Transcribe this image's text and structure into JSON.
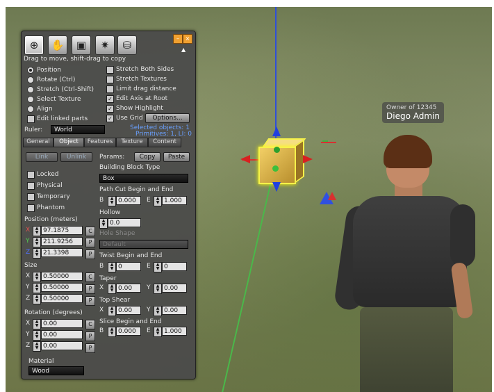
{
  "nametag": {
    "owner": "Owner of 12345",
    "name": "Diego Admin"
  },
  "tools": {
    "icons": [
      "zoom-icon",
      "move-icon",
      "edit-icon",
      "create-wand-icon",
      "land-icon"
    ],
    "glyphs": [
      "⊕",
      "✋",
      "▣",
      "✷",
      "⛁"
    ],
    "minimize": "–",
    "close": "×",
    "expand": "▲"
  },
  "hint": "Drag to move, shift-drag to copy",
  "modes": [
    {
      "label": "Position",
      "selected": true
    },
    {
      "label": "Rotate (Ctrl)",
      "selected": false
    },
    {
      "label": "Stretch (Ctrl-Shift)",
      "selected": false
    },
    {
      "label": "Select Texture",
      "selected": false
    },
    {
      "label": "Align",
      "selected": false
    }
  ],
  "edit_linked": {
    "label": "Edit linked parts",
    "checked": false
  },
  "options": [
    {
      "label": "Stretch Both Sides",
      "checked": false
    },
    {
      "label": "Stretch Textures",
      "checked": false
    },
    {
      "label": "Limit drag distance",
      "checked": false
    },
    {
      "label": "Edit Axis at Root",
      "checked": true
    },
    {
      "label": "Show Highlight",
      "checked": true
    },
    {
      "label": "Use Grid",
      "checked": true
    }
  ],
  "options_button": "Options...",
  "ruler": {
    "label": "Ruler:",
    "value": "World"
  },
  "selected_objects": "Selected objects: 1",
  "primitives": "Primitives: 1, LI: 0",
  "tabs": [
    "General",
    "Object",
    "Features",
    "Texture",
    "Content"
  ],
  "link_btn": "Link",
  "unlink_btn": "Unlink",
  "params": {
    "label": "Params:",
    "copy": "Copy",
    "paste": "Paste"
  },
  "flags": [
    {
      "label": "Locked"
    },
    {
      "label": "Physical"
    },
    {
      "label": "Temporary"
    },
    {
      "label": "Phantom"
    }
  ],
  "position": {
    "title": "Position (meters)",
    "rows": [
      {
        "axis": "X",
        "value": "97.1875",
        "btn": "C",
        "color": "#e05050"
      },
      {
        "axis": "Y",
        "value": "211.9256",
        "btn": "P",
        "color": "#50d050"
      },
      {
        "axis": "Z",
        "value": "21.3398",
        "btn": "P",
        "color": "#5070ff"
      }
    ]
  },
  "size": {
    "title": "Size",
    "rows": [
      {
        "axis": "X",
        "value": "0.50000",
        "btn": "C"
      },
      {
        "axis": "Y",
        "value": "0.50000",
        "btn": "P"
      },
      {
        "axis": "Z",
        "value": "0.50000",
        "btn": "P"
      }
    ]
  },
  "rotation": {
    "title": "Rotation (degrees)",
    "rows": [
      {
        "axis": "X",
        "value": "0.00",
        "btn": "C"
      },
      {
        "axis": "Y",
        "value": "0.00",
        "btn": "P"
      },
      {
        "axis": "Z",
        "value": "0.00",
        "btn": "P"
      }
    ]
  },
  "material": {
    "label": "Material",
    "value": "Wood"
  },
  "shape": {
    "title": "Building Block Type",
    "value": "Box",
    "path_cut": {
      "title": "Path Cut Begin and End",
      "b_label": "B",
      "b": "0.000",
      "e_label": "E",
      "e": "1.000"
    },
    "hollow": {
      "title": "Hollow",
      "value": "0.0"
    },
    "hole": {
      "title": "Hole Shape",
      "value": "Default"
    },
    "twist": {
      "title": "Twist Begin and End",
      "b_label": "B",
      "b": "0",
      "e_label": "E",
      "e": "0"
    },
    "taper": {
      "title": "Taper",
      "x_label": "X",
      "x": "0.00",
      "y_label": "Y",
      "y": "0.00"
    },
    "shear": {
      "title": "Top Shear",
      "x_label": "X",
      "x": "0.00",
      "y_label": "Y",
      "y": "0.00"
    },
    "slice": {
      "title": "Slice Begin and End",
      "b_label": "B",
      "b": "0.000",
      "e_label": "E",
      "e": "1.000"
    }
  },
  "colors": {
    "x_axis": "#d83030",
    "y_axis": "#30b030",
    "z_axis": "#3050e0",
    "highlight": "#f6f24a"
  }
}
